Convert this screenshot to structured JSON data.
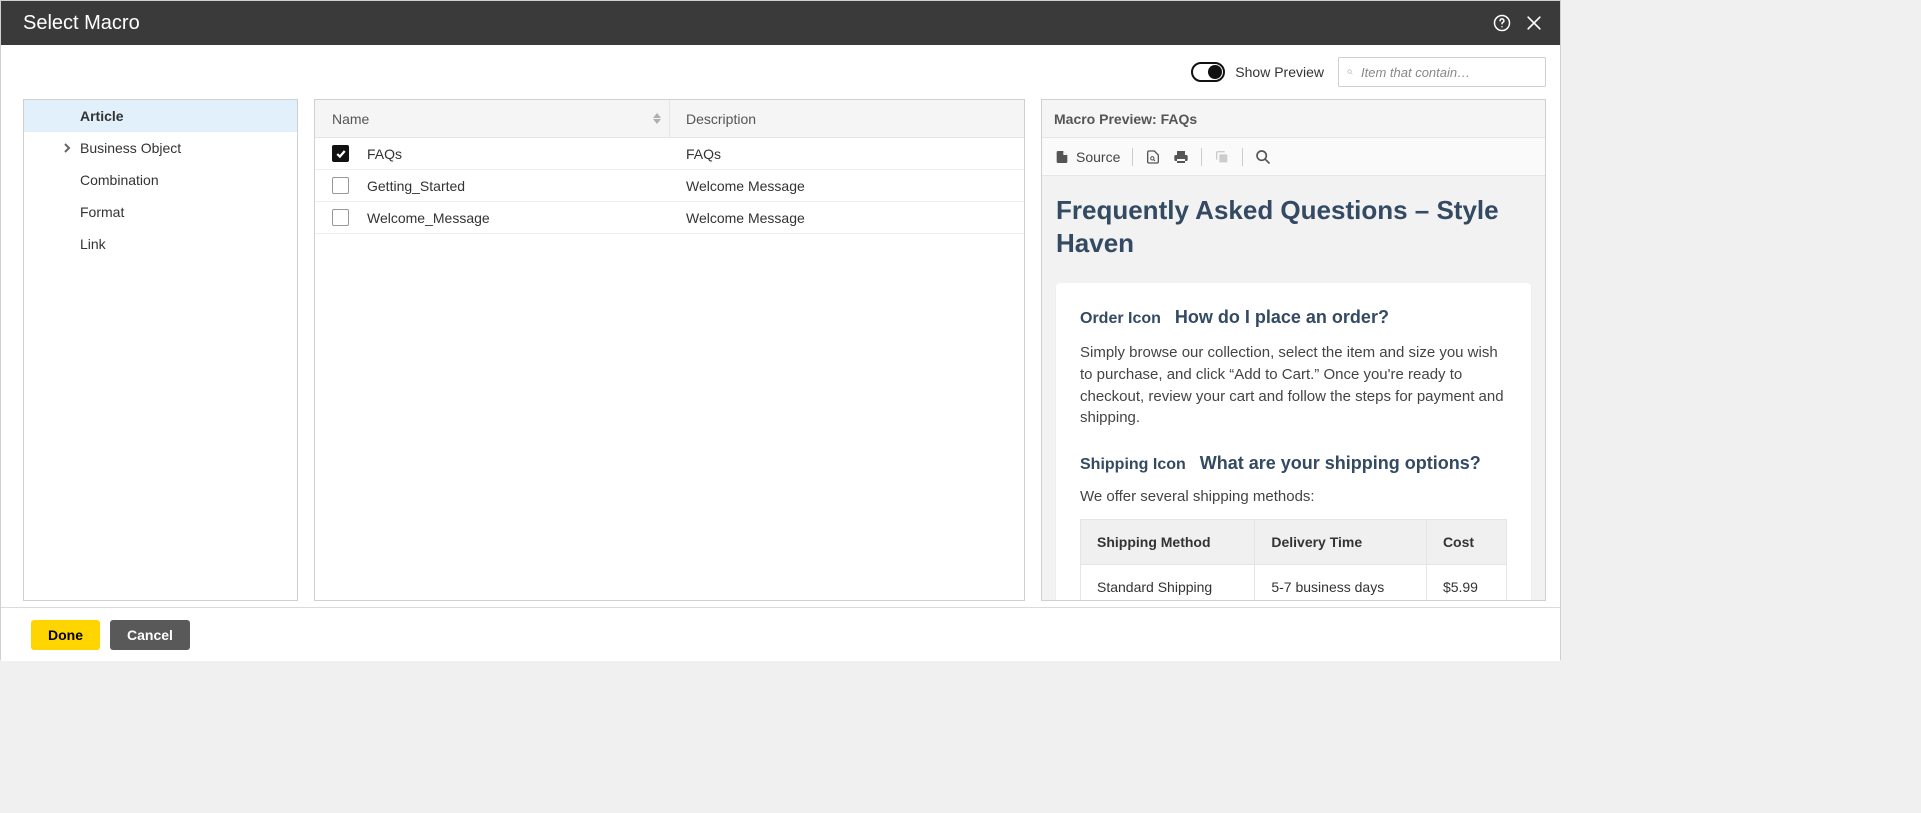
{
  "dialog": {
    "title": "Select Macro"
  },
  "topbar": {
    "toggle_label": "Show Preview",
    "search_placeholder": "Item that contain…"
  },
  "tree": {
    "items": [
      {
        "label": "Article",
        "selected": true,
        "chevron": false
      },
      {
        "label": "Business Object",
        "selected": false,
        "chevron": true
      },
      {
        "label": "Combination",
        "selected": false,
        "chevron": false
      },
      {
        "label": "Format",
        "selected": false,
        "chevron": false
      },
      {
        "label": "Link",
        "selected": false,
        "chevron": false
      }
    ]
  },
  "list": {
    "col_name": "Name",
    "col_desc": "Description",
    "rows": [
      {
        "checked": true,
        "name": "FAQs",
        "desc": "FAQs"
      },
      {
        "checked": false,
        "name": "Getting_Started",
        "desc": "Welcome Message"
      },
      {
        "checked": false,
        "name": "Welcome_Message",
        "desc": "Welcome Message"
      }
    ]
  },
  "preview": {
    "header_label": "Macro Preview: FAQs",
    "toolbar": {
      "source": "Source"
    },
    "title": "Frequently Asked Questions – Style Haven",
    "faqs": [
      {
        "icon_label": "Order Icon",
        "question": "How do I place an order?",
        "answer": "Simply browse our collection, select the item and size you wish to purchase, and click “Add to Cart.” Once you're ready to checkout, review your cart and follow the steps for payment and shipping."
      },
      {
        "icon_label": "Shipping Icon",
        "question": "What are your shipping options?",
        "intro": "We offer several shipping methods:"
      }
    ],
    "shipping_table": {
      "headers": [
        "Shipping Method",
        "Delivery Time",
        "Cost"
      ],
      "rows": [
        [
          "Standard Shipping",
          "5-7 business days",
          "$5.99"
        ]
      ]
    }
  },
  "footer": {
    "done": "Done",
    "cancel": "Cancel"
  }
}
